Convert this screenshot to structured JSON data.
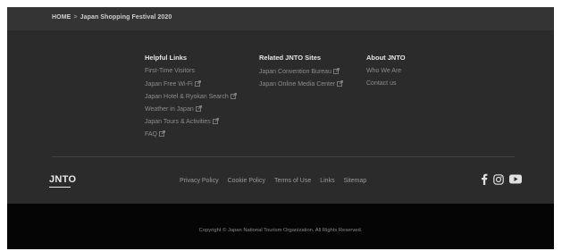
{
  "breadcrumb": {
    "home": "HOME",
    "separator": ">",
    "current": "Japan Shopping Festival 2020"
  },
  "helpful_links": {
    "title": "Helpful Links",
    "items": [
      {
        "label": "First-Time Visitors",
        "external": false
      },
      {
        "label": "Japan Free Wi-Fi",
        "external": true
      },
      {
        "label": "Japan Hotel & Ryokan Search",
        "external": true
      },
      {
        "label": "Weather in Japan",
        "external": true
      },
      {
        "label": "Japan Tours & Activities",
        "external": true
      },
      {
        "label": "FAQ",
        "external": true
      }
    ]
  },
  "related_sites": {
    "title": "Related JNTO Sites",
    "items": [
      {
        "label": "Japan Convention Bureau",
        "external": true
      },
      {
        "label": "Japan Online Media Center",
        "external": true
      }
    ]
  },
  "about": {
    "title": "About JNTO",
    "items": [
      {
        "label": "Who We Are",
        "external": false
      },
      {
        "label": "Contact us",
        "external": false
      }
    ]
  },
  "logo": {
    "text": "JNTO"
  },
  "footer_nav": {
    "privacy": "Privacy Policy",
    "cookie": "Cookie Policy",
    "terms": "Terms of Use",
    "links": "Links",
    "sitemap": "Sitemap"
  },
  "social": {
    "icons": [
      "facebook-icon",
      "instagram-icon",
      "youtube-icon"
    ]
  },
  "copyright": "Copyright © Japan National Tourism Organization. All Rights Reserved.",
  "colors": {
    "footer_bg": "#2b2b2b",
    "breadcrumb_bg": "#343434",
    "bottom_bg": "#050505",
    "link_text": "#8c8c8c",
    "heading_text": "#e6e6e6"
  }
}
